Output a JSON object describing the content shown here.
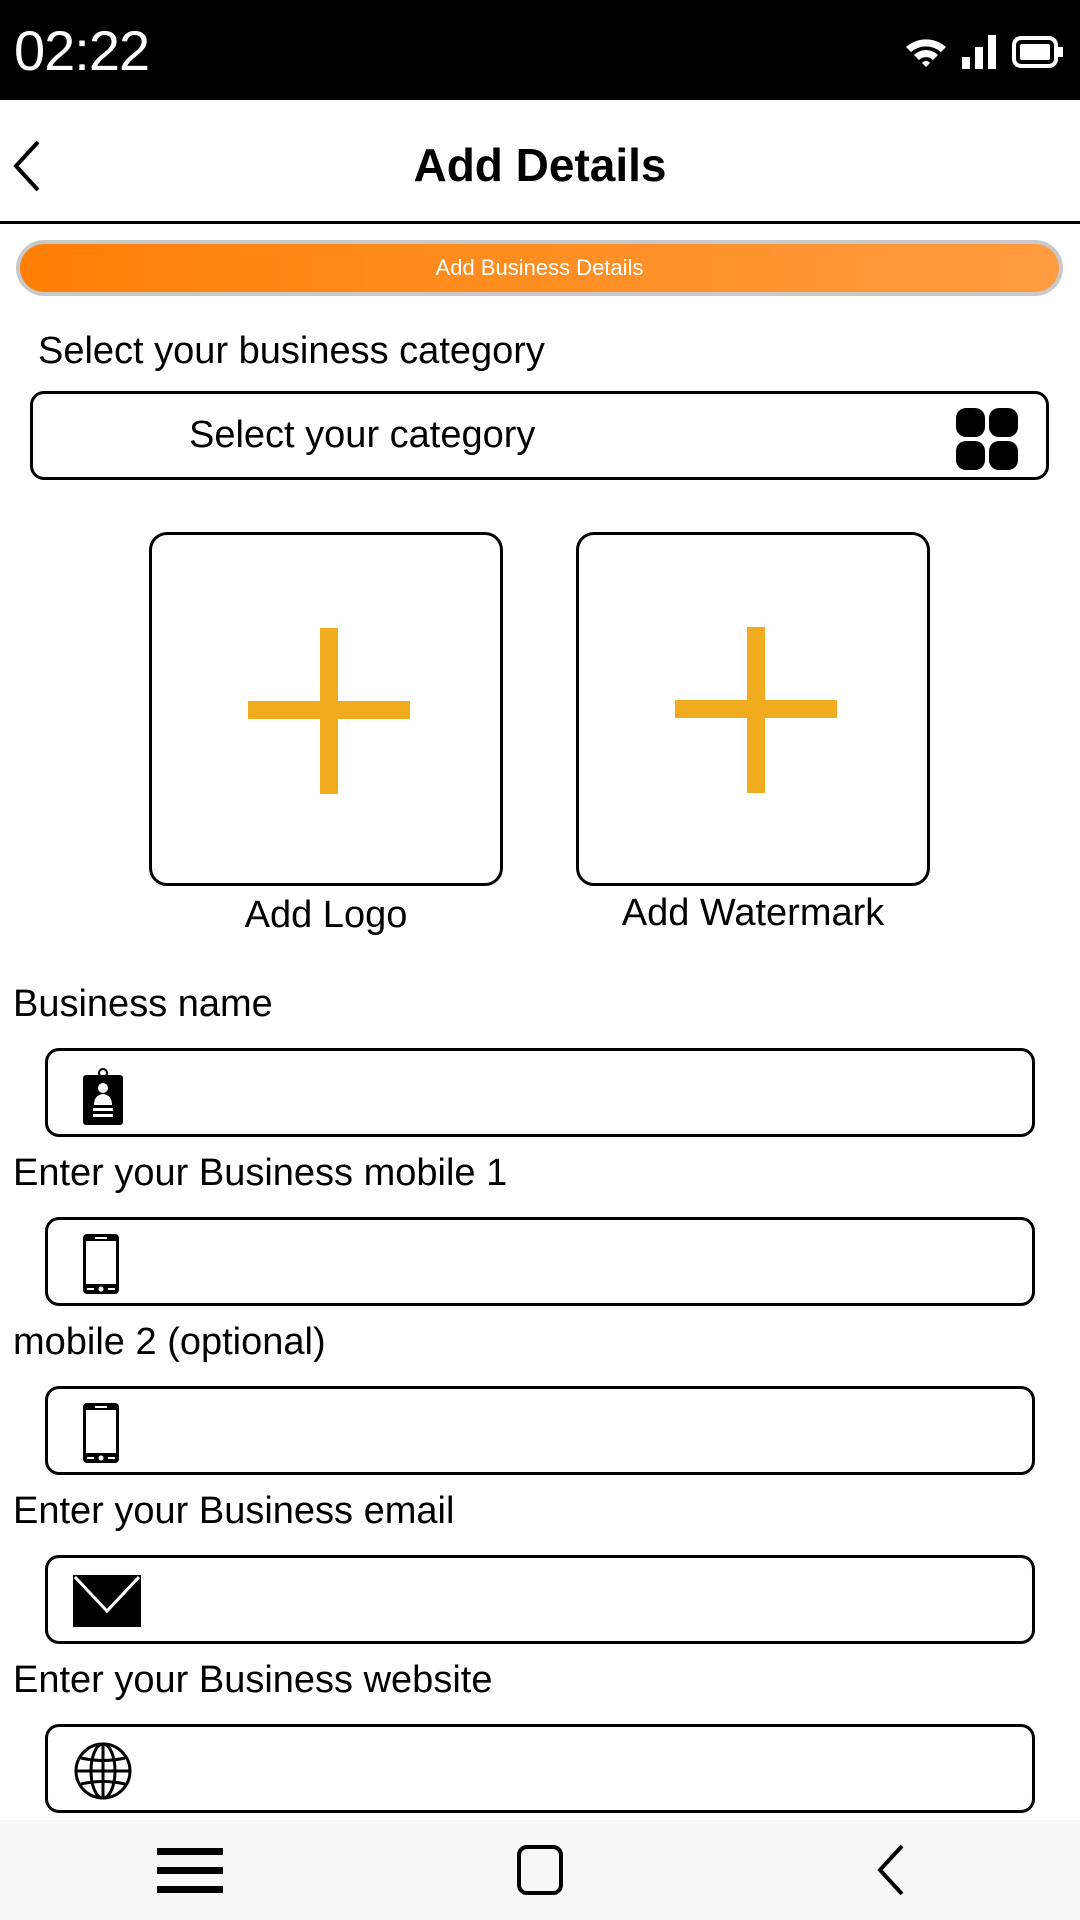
{
  "status_bar": {
    "time": "02:22",
    "icons": [
      "wifi-icon",
      "signal-icon",
      "battery-icon"
    ]
  },
  "header": {
    "title": "Add Details",
    "back_icon": "chevron-left-icon"
  },
  "step_banner": {
    "label": "Add Business Details",
    "colors": {
      "start": "#ff7f06",
      "end": "#ff9c40",
      "border": "#c9c9c9"
    }
  },
  "category": {
    "section_label": "Select your business category",
    "placeholder": "Select your category",
    "icon": "grid-icon"
  },
  "uploads": [
    {
      "label": "Add Logo",
      "icon": "plus-icon"
    },
    {
      "label": "Add Watermark",
      "icon": "plus-icon"
    }
  ],
  "accent_color": "#f0ab1e",
  "fields": [
    {
      "label": "Business name",
      "value": "",
      "icon": "id-badge-icon"
    },
    {
      "label": "Enter your Business mobile 1",
      "value": "",
      "icon": "smartphone-icon"
    },
    {
      "label": "mobile 2 (optional)",
      "value": "",
      "icon": "smartphone-icon"
    },
    {
      "label": "Enter your Business email",
      "value": "",
      "icon": "envelope-icon"
    },
    {
      "label": "Enter your Business website",
      "value": "",
      "icon": "globe-icon"
    }
  ],
  "nav_bar": {
    "buttons": [
      "recent-apps-icon",
      "home-icon",
      "back-icon"
    ]
  }
}
